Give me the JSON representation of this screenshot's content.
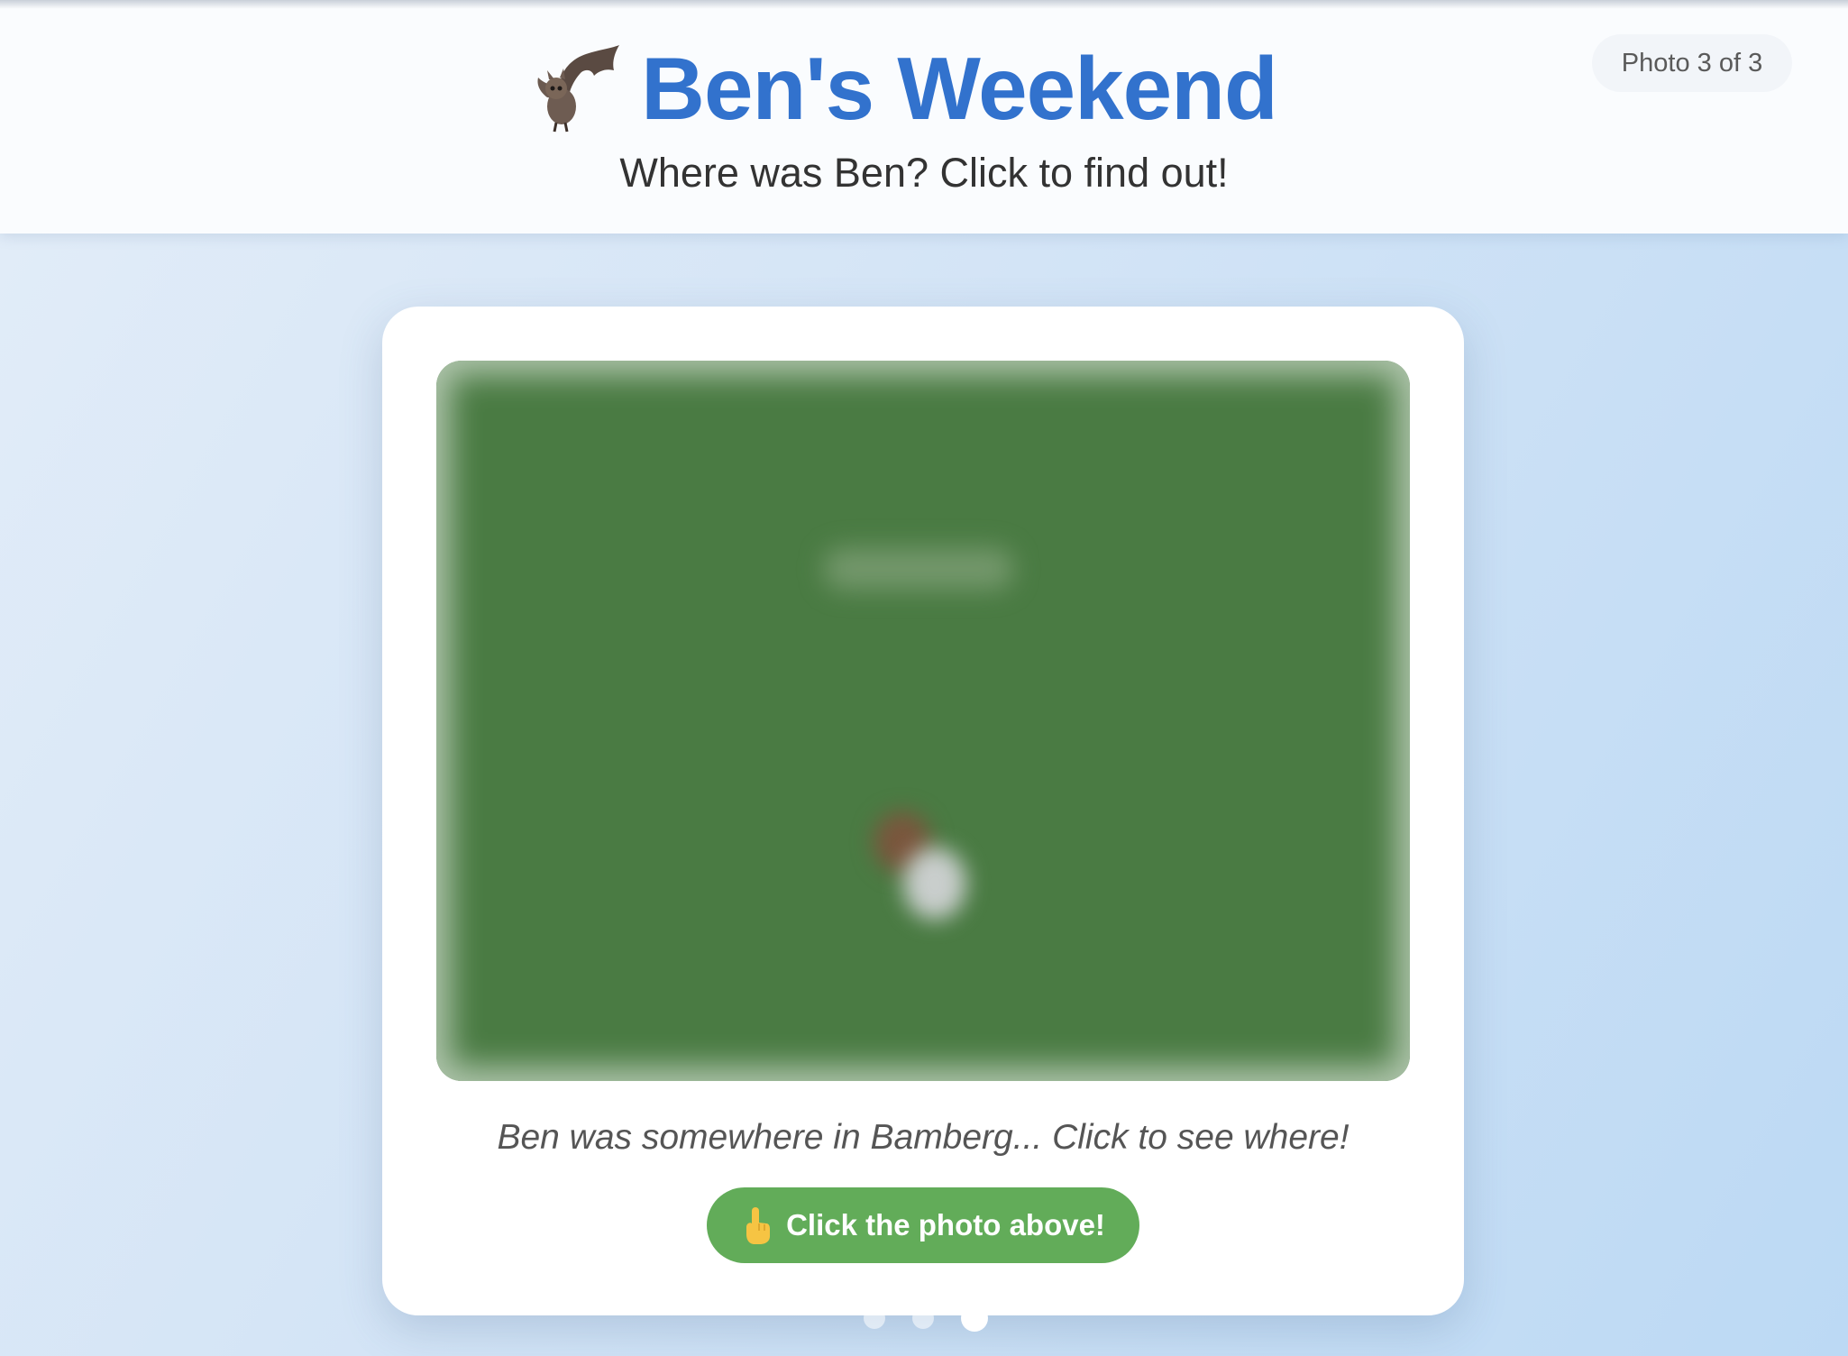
{
  "header": {
    "title": "Ben's Weekend",
    "subtitle": "Where was Ben? Click to find out!",
    "title_icon": "bat-icon",
    "counter": "Photo 3 of 3"
  },
  "card": {
    "caption": "Ben was somewhere in Bamberg... Click to see where!",
    "button_label": "Click the photo above!",
    "button_icon": "pointing-hand-icon"
  },
  "pagination": {
    "total": 3,
    "current": 3
  },
  "colors": {
    "title": "#3272cd",
    "button": "#62ac59",
    "photo": "#4a7b43"
  }
}
